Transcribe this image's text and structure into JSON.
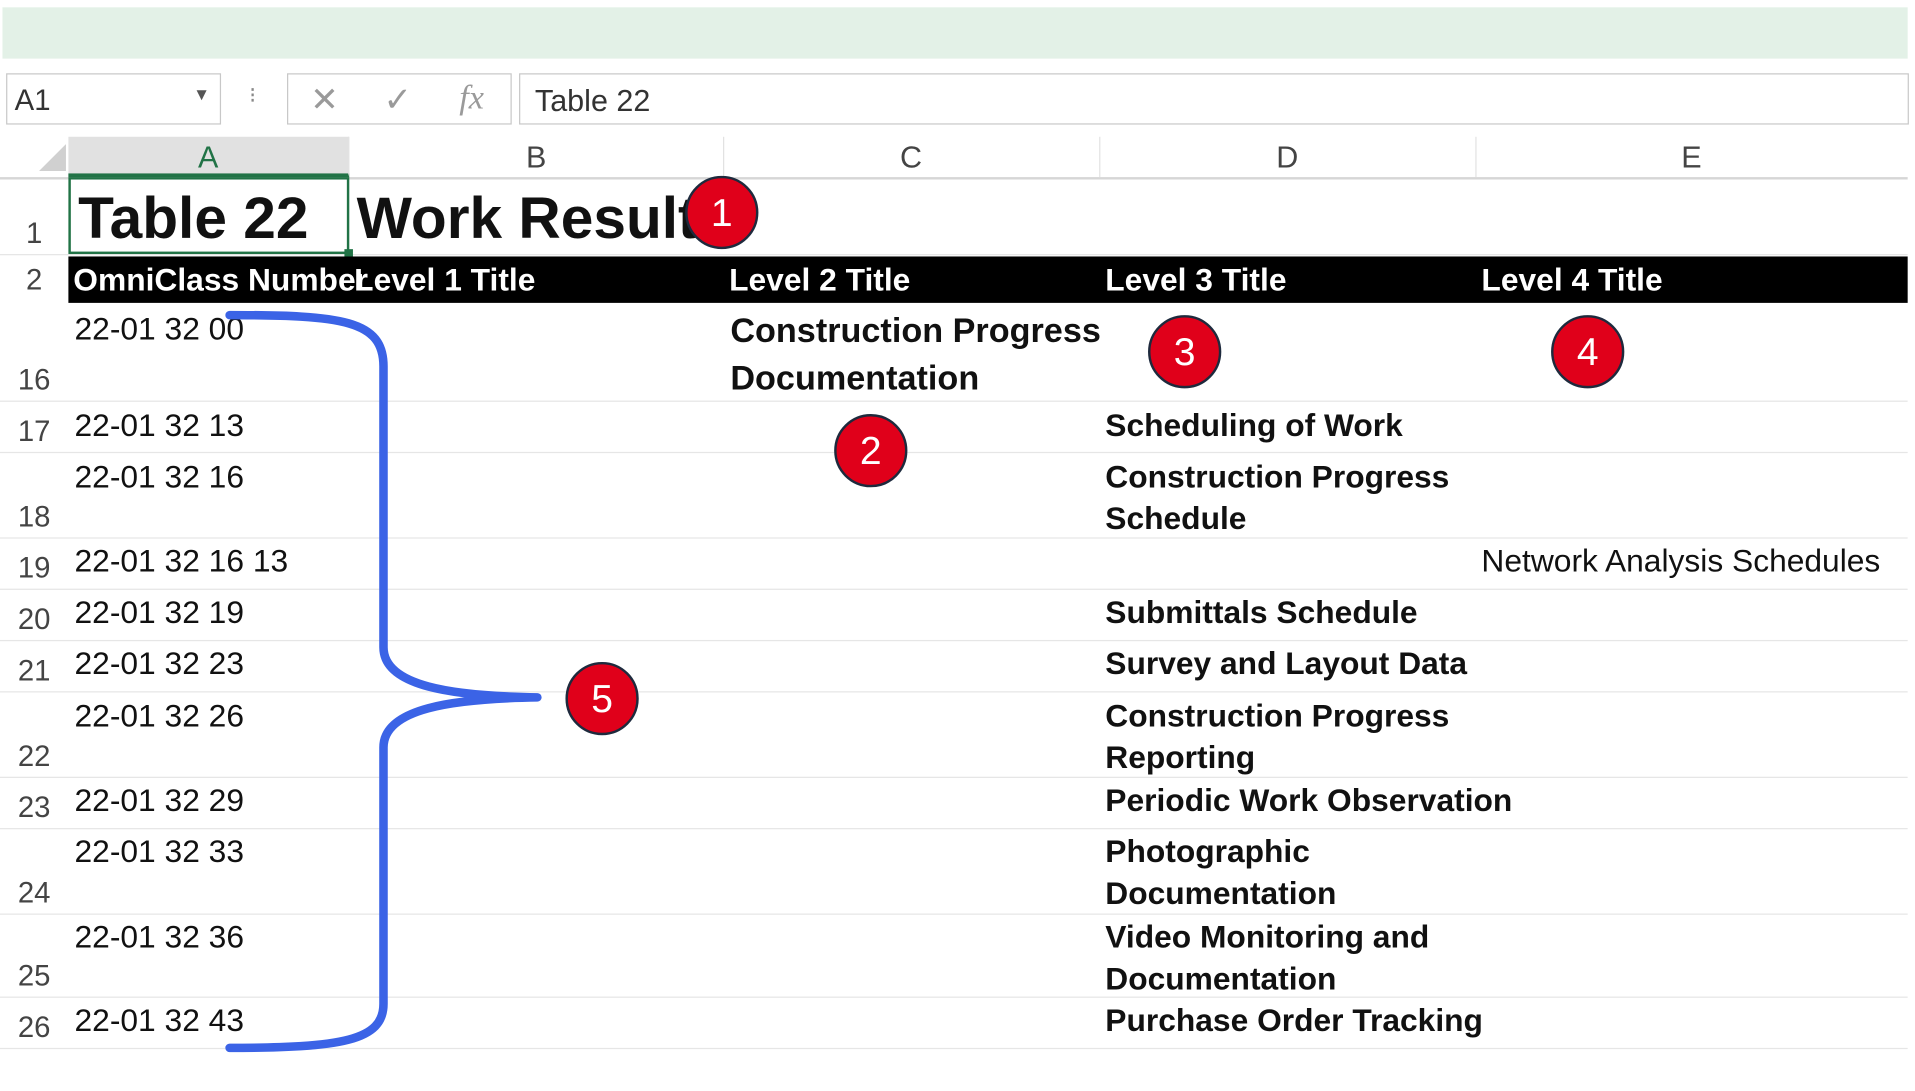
{
  "formula_bar": {
    "name_box": "A1",
    "cancel_glyph": "✕",
    "enter_glyph": "✓",
    "fx_label": "fx",
    "value": "Table 22"
  },
  "columns": [
    "A",
    "B",
    "C",
    "D",
    "E"
  ],
  "selected_column": "A",
  "title": {
    "a": "Table 22",
    "b": "Work Results"
  },
  "header_row": {
    "row": "2",
    "a": "OmniClass Number",
    "b": "Level 1 Title",
    "c": "Level 2 Title",
    "d": "Level 3 Title",
    "e": "Level 4 Title"
  },
  "rows": [
    {
      "row": "1"
    },
    {
      "row": "16",
      "a": "22-01 32 00",
      "c1": "Construction Progress",
      "c2": "Documentation"
    },
    {
      "row": "17",
      "a": "22-01 32 13",
      "d1": "Scheduling of Work"
    },
    {
      "row": "18",
      "a": "22-01 32 16",
      "d1": "Construction Progress",
      "d2": "Schedule"
    },
    {
      "row": "19",
      "a": "22-01 32 16 13",
      "e": "Network Analysis Schedules"
    },
    {
      "row": "20",
      "a": "22-01 32 19",
      "d1": "Submittals Schedule"
    },
    {
      "row": "21",
      "a": "22-01 32 23",
      "d1": "Survey and Layout Data"
    },
    {
      "row": "22",
      "a": "22-01 32 26",
      "d1": "Construction Progress",
      "d2": "Reporting"
    },
    {
      "row": "23",
      "a": "22-01 32 29",
      "d1": "Periodic Work Observation"
    },
    {
      "row": "24",
      "a": "22-01 32 33",
      "d1": "Photographic",
      "d2": "Documentation"
    },
    {
      "row": "25",
      "a": "22-01 32 36",
      "d1": "Video Monitoring and",
      "d2": "Documentation"
    },
    {
      "row": "26",
      "a": "22-01 32 43",
      "d1": "Purchase Order Tracking"
    }
  ],
  "callouts": [
    "1",
    "2",
    "3",
    "4",
    "5"
  ],
  "colors": {
    "ribbon": "#e3f1e7",
    "selection": "#217346",
    "header_bar": "#000000",
    "callout_fill": "#e0001a",
    "brace": "#3b63e6"
  }
}
